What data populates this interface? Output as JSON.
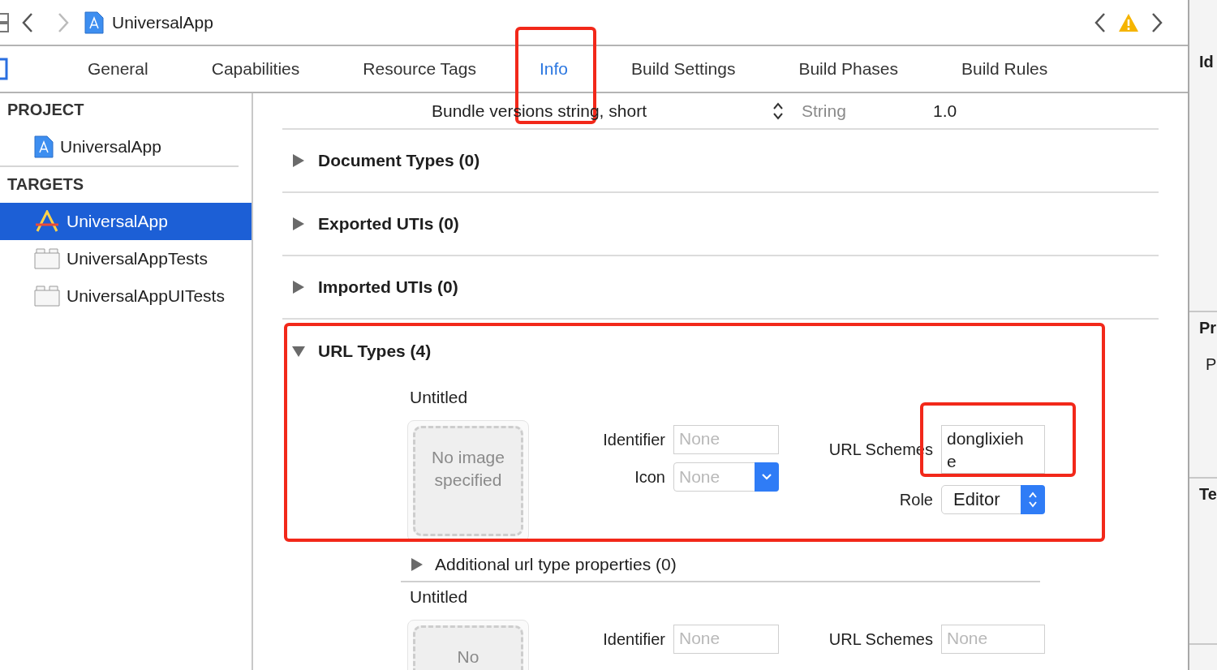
{
  "toolbar": {
    "title": "UniversalApp",
    "back_enabled": true,
    "forward_enabled": false,
    "issue_warning": true
  },
  "tabs": [
    {
      "label": "General",
      "selected": false,
      "highlighted": false
    },
    {
      "label": "Capabilities",
      "selected": false,
      "highlighted": false
    },
    {
      "label": "Resource Tags",
      "selected": false,
      "highlighted": false
    },
    {
      "label": "Info",
      "selected": true,
      "highlighted": true
    },
    {
      "label": "Build Settings",
      "selected": false,
      "highlighted": false
    },
    {
      "label": "Build Phases",
      "selected": false,
      "highlighted": false
    },
    {
      "label": "Build Rules",
      "selected": false,
      "highlighted": false
    }
  ],
  "sidebar": {
    "sections": [
      {
        "heading": "PROJECT",
        "items": [
          {
            "label": "UniversalApp",
            "kind": "project",
            "selected": false
          }
        ]
      },
      {
        "heading": "TARGETS",
        "items": [
          {
            "label": "UniversalApp",
            "kind": "app",
            "selected": true
          },
          {
            "label": "UniversalAppTests",
            "kind": "bundle",
            "selected": false
          },
          {
            "label": "UniversalAppUITests",
            "kind": "bundle",
            "selected": false
          }
        ]
      }
    ]
  },
  "plist_row": {
    "key": "Bundle versions string, short",
    "type": "String",
    "value": "1.0"
  },
  "sections": [
    {
      "title": "Document Types (0)",
      "expanded": false
    },
    {
      "title": "Exported UTIs (0)",
      "expanded": false
    },
    {
      "title": "Imported UTIs (0)",
      "expanded": false
    },
    {
      "title": "URL Types (4)",
      "expanded": true,
      "highlighted": true,
      "entries": [
        {
          "title": "Untitled",
          "image_placeholder": "No image specified",
          "identifier": {
            "label": "Identifier",
            "placeholder": "None"
          },
          "icon": {
            "label": "Icon",
            "placeholder": "None"
          },
          "url_schemes": {
            "label": "URL Schemes",
            "value": "donglixiehe",
            "highlighted": true
          },
          "role": {
            "label": "Role",
            "value": "Editor"
          },
          "additional": {
            "title": "Additional url type properties (0)",
            "expanded": false
          }
        },
        {
          "title": "Untitled",
          "image_placeholder": "No",
          "identifier": {
            "label": "Identifier",
            "placeholder": "None"
          },
          "url_schemes": {
            "label": "URL Schemes",
            "placeholder": "None"
          }
        }
      ]
    }
  ],
  "inspector": [
    {
      "heading": "Id"
    },
    {
      "heading": "Pr",
      "items": [
        "P"
      ]
    },
    {
      "heading": "Te"
    }
  ]
}
